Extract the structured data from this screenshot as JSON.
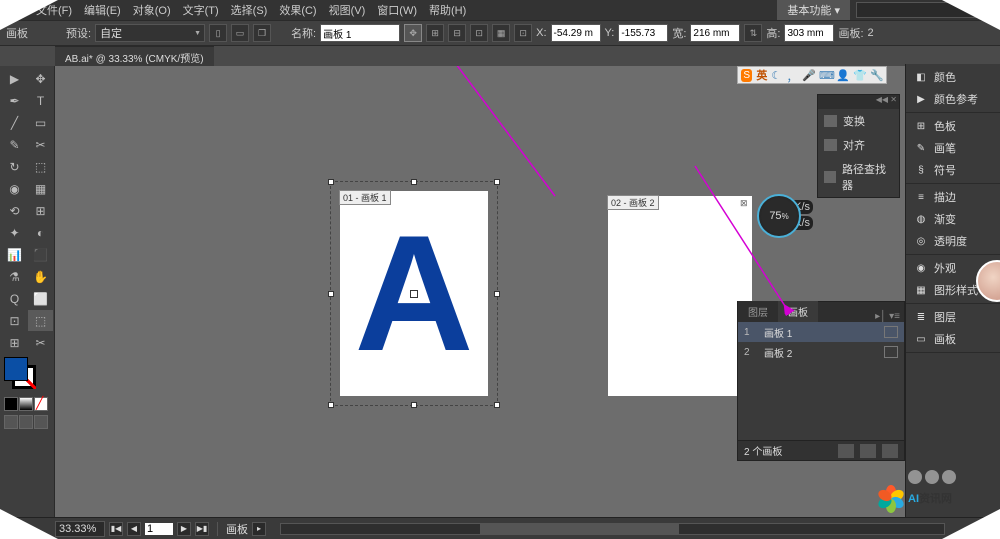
{
  "menubar": {
    "items": [
      "文件(F)",
      "编辑(E)",
      "对象(O)",
      "文字(T)",
      "选择(S)",
      "效果(C)",
      "视图(V)",
      "窗口(W)",
      "帮助(H)"
    ],
    "basic_func": "基本功能 ▾"
  },
  "controlbar": {
    "leftlabel": "画板",
    "preset_label": "预设:",
    "preset_value": "自定",
    "name_label": "名称:",
    "name_value": "画板 1",
    "x_label": "X:",
    "x_value": "-54.29 m",
    "y_label": "Y:",
    "y_value": "-155.73",
    "w_label": "宽:",
    "w_value": "216 mm",
    "h_label": "高:",
    "h_value": "303 mm",
    "artboards_label": "画板:",
    "artboards_value": "2"
  },
  "doc_tab": "AB.ai* @ 33.33% (CMYK/预览)",
  "artboard1": {
    "label": "01 - 画板 1",
    "letter": "A"
  },
  "artboard2": {
    "label": "02 - 画板 2"
  },
  "popup1": {
    "items": [
      "变换",
      "对齐",
      "路径查找器"
    ]
  },
  "popup2": {
    "tabs": [
      "图层",
      "画板"
    ],
    "rows": [
      {
        "idx": "1",
        "name": "画板 1"
      },
      {
        "idx": "2",
        "name": "画板 2"
      }
    ],
    "count": "2 个画板"
  },
  "rightdock": {
    "groups": [
      [
        "颜色",
        "颜色参考"
      ],
      [
        "色板",
        "画笔",
        "符号"
      ],
      [
        "描边",
        "渐变",
        "透明度"
      ],
      [
        "外观",
        "图形样式"
      ],
      [
        "图层",
        "画板"
      ]
    ]
  },
  "dial": "75",
  "dial_pct": "%",
  "dial_badges": [
    "0K/s",
    "0K/s"
  ],
  "float_tb_text": "英",
  "statusbar": {
    "zoom": "33.33%",
    "page": "1",
    "label": "画板"
  },
  "watermark": {
    "text": "AI资讯网"
  },
  "colors": {
    "accent_blue": "#0b3e9c",
    "arrow": "#d400d4",
    "petals": [
      "#ff5a2a",
      "#ffc600",
      "#29abe2",
      "#8cc63f",
      "#00a99d",
      "#f15a24"
    ]
  }
}
